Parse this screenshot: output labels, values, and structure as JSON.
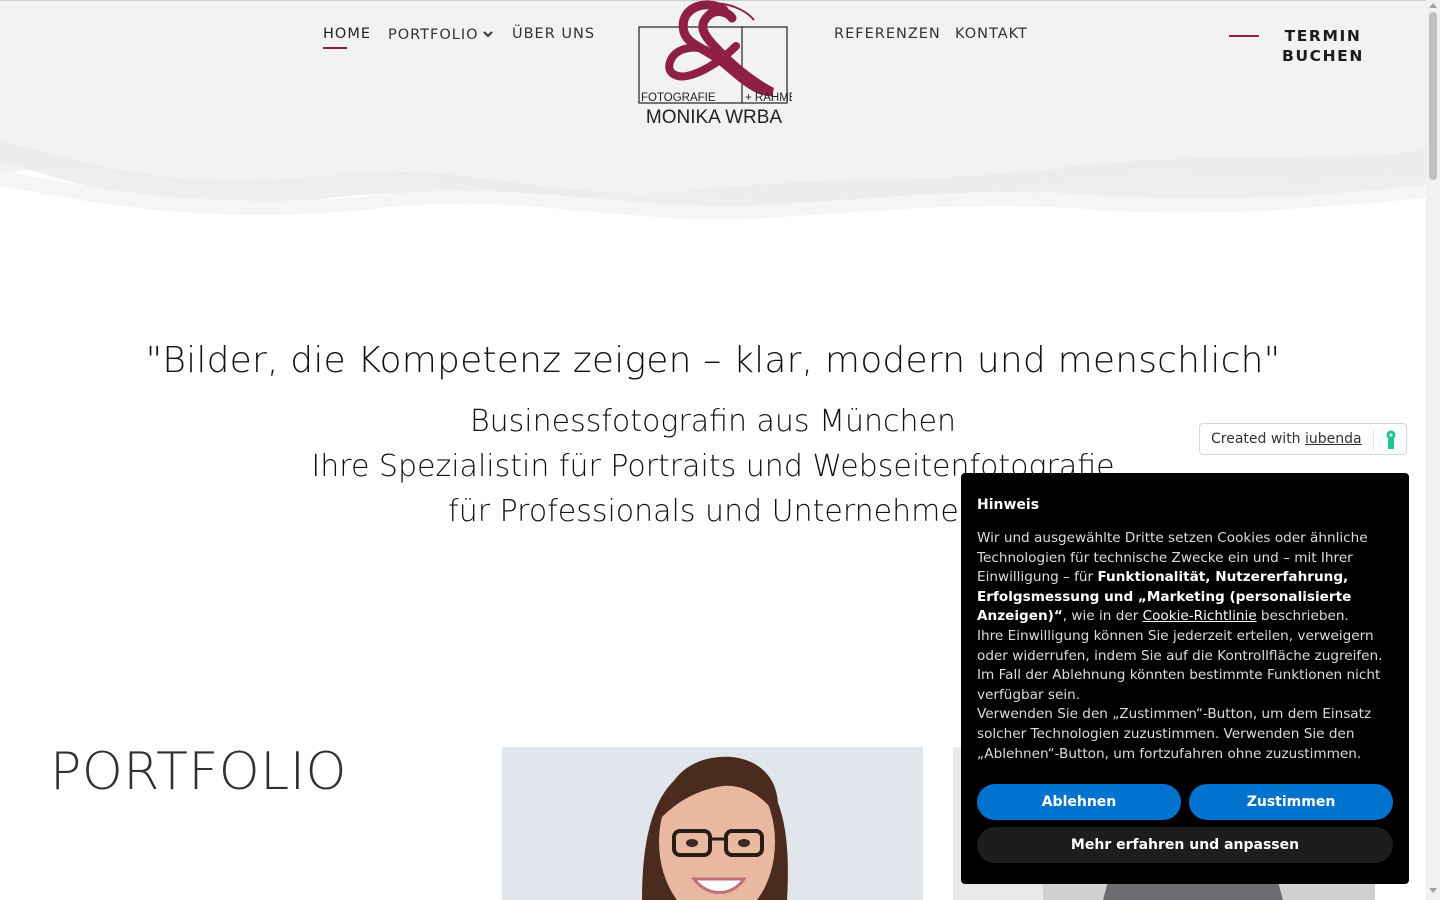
{
  "nav": {
    "items": [
      {
        "label": "HOME"
      },
      {
        "label": "PORTFOLIO"
      },
      {
        "label": "ÜBER UNS"
      },
      {
        "label": "REFERENZEN"
      },
      {
        "label": "KONTAKT"
      }
    ],
    "cta_line1": "TERMIN",
    "cta_line2": "BUCHEN"
  },
  "logo": {
    "left_text": "FOTOGRAFIE",
    "right_text": "+ RAHMEN",
    "name": "MONIKA WRBA"
  },
  "hero": {
    "quote": "\"Bilder, die Kompetenz zeigen – klar, modern und menschlich\"",
    "line1": "Businessfotografin aus München",
    "line2": "Ihre Spezialistin für Portraits und Webseitenfotografie",
    "line3": "für Professionals und Unternehmen"
  },
  "portfolio": {
    "title": "PORTFOLIO"
  },
  "iubenda_badge": {
    "prefix": "Created with",
    "link": "iubenda"
  },
  "cookie": {
    "title": "Hinweis",
    "p1_a": "Wir und ausgewählte Dritte setzen Cookies oder ähnliche Technologien für technische Zwecke ein und – mit Ihrer Einwilligung – für ",
    "p1_bold": "Funktionalität, Nutzererfahrung, Erfolgsmessung und „Marketing (personalisierte Anzeigen)“",
    "p1_b": ", wie in der ",
    "p1_link": "Cookie-Richtlinie",
    "p1_c": " beschrieben.",
    "p2": "Ihre Einwilligung können Sie jederzeit erteilen, verweigern oder widerrufen, indem Sie auf die Kontrollfläche zugreifen. Im Fall der Ablehnung könnten bestimmte Funktionen nicht verfügbar sein.",
    "p3": "Verwenden Sie den „Zustimmen“-Button, um dem Einsatz solcher Technologien zuzustimmen. Verwenden Sie den „Ablehnen“-Button, um fortzufahren ohne zuzustimmen.",
    "reject": "Ablehnen",
    "accept": "Zustimmen",
    "more": "Mehr erfahren und anpassen"
  },
  "colors": {
    "accent": "#8e1f45",
    "button_blue": "#0073ce"
  }
}
